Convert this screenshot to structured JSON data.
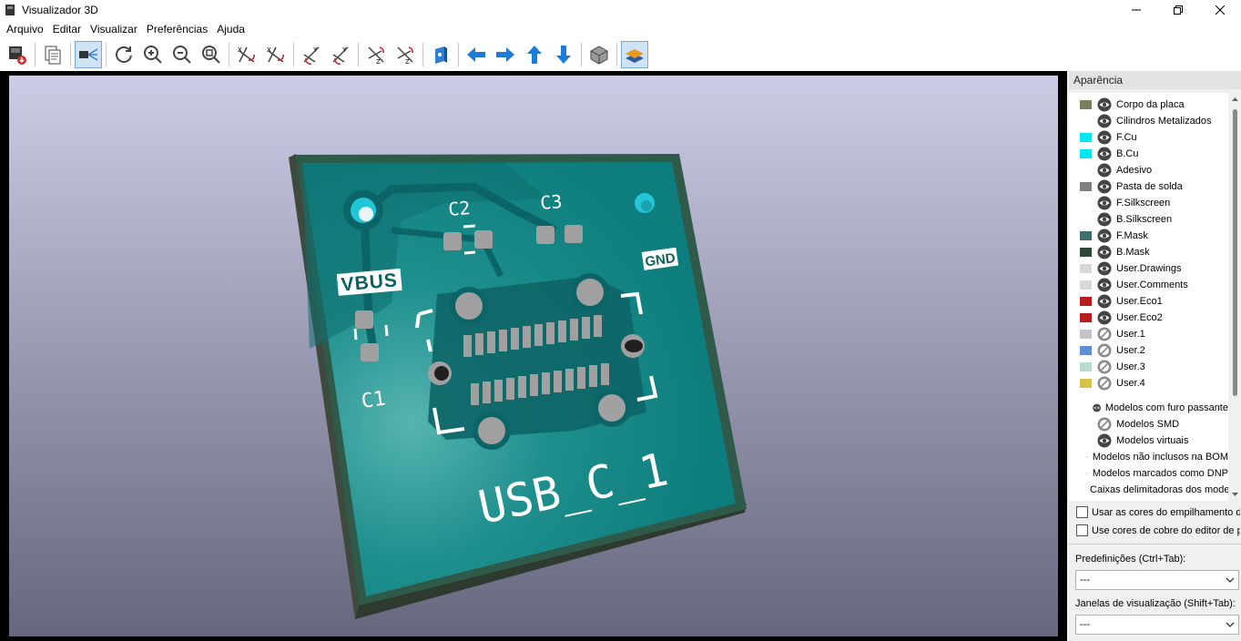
{
  "window": {
    "title": "Visualizador 3D"
  },
  "menu": [
    "Arquivo",
    "Editar",
    "Visualizar",
    "Preferências",
    "Ajuda"
  ],
  "toolbar": {
    "buttons": [
      "export-icon",
      "copy-icon",
      "raytrace-icon",
      "reload-icon",
      "zoom-in-icon",
      "zoom-out-icon",
      "zoom-fit-icon",
      "rotate-x-cw-icon",
      "rotate-x-ccw-icon",
      "rotate-y-cw-icon",
      "rotate-y-ccw-icon",
      "rotate-z-cw-icon",
      "rotate-z-ccw-icon",
      "flip-board-icon",
      "arrow-left-icon",
      "arrow-right-icon",
      "arrow-up-icon",
      "arrow-down-icon",
      "ortho-icon",
      "layers-icon"
    ]
  },
  "board": {
    "labels": {
      "vbus": "VBUS",
      "gnd": "GND",
      "c1": "C1",
      "c2": "C2",
      "c3": "C3",
      "name": "USB_C_1"
    }
  },
  "panel": {
    "title": "Aparência",
    "layers": [
      {
        "label": "Corpo da placa",
        "color": "#7a805a",
        "visible": true
      },
      {
        "label": "Cilindros Metalizados",
        "color": "",
        "visible": true
      },
      {
        "label": "F.Cu",
        "color": "#00e6f0",
        "visible": true
      },
      {
        "label": "B.Cu",
        "color": "#00e6f0",
        "visible": true
      },
      {
        "label": "Adesivo",
        "color": "",
        "visible": true
      },
      {
        "label": "Pasta de solda",
        "color": "#808080",
        "visible": true
      },
      {
        "label": "F.Silkscreen",
        "color": "",
        "visible": true
      },
      {
        "label": "B.Silkscreen",
        "color": "",
        "visible": true
      },
      {
        "label": "F.Mask",
        "color": "#3f6e6e",
        "visible": true
      },
      {
        "label": "B.Mask",
        "color": "#294a3a",
        "visible": true
      },
      {
        "label": "User.Drawings",
        "color": "#d8d8d8",
        "visible": true
      },
      {
        "label": "User.Comments",
        "color": "#d8d8d8",
        "visible": true
      },
      {
        "label": "User.Eco1",
        "color": "#b91c1c",
        "visible": true
      },
      {
        "label": "User.Eco2",
        "color": "#b91c1c",
        "visible": true
      },
      {
        "label": "User.1",
        "color": "#c4c4c4",
        "visible": false
      },
      {
        "label": "User.2",
        "color": "#5b8fd6",
        "visible": false
      },
      {
        "label": "User.3",
        "color": "#b8dccf",
        "visible": false
      },
      {
        "label": "User.4",
        "color": "#d8c34a",
        "visible": false
      }
    ],
    "models": [
      {
        "label": "Modelos com furo passante",
        "visible": true
      },
      {
        "label": "Modelos SMD",
        "visible": false
      },
      {
        "label": "Modelos virtuais",
        "visible": true
      },
      {
        "label": "Modelos não inclusos na BOM",
        "visible": false
      },
      {
        "label": "Modelos marcados como DNP",
        "visible": false
      },
      {
        "label": "Caixas delimitadoras dos modelos",
        "visible": false
      }
    ],
    "checkbox_stackup": "Usar as cores do empilhamento da placa",
    "checkbox_copper": "Use cores de cobre do editor de placa",
    "presets_label": "Predefinições (Ctrl+Tab):",
    "presets_value": "---",
    "views_label": "Janelas de visualização (Shift+Tab):",
    "views_value": "---"
  }
}
